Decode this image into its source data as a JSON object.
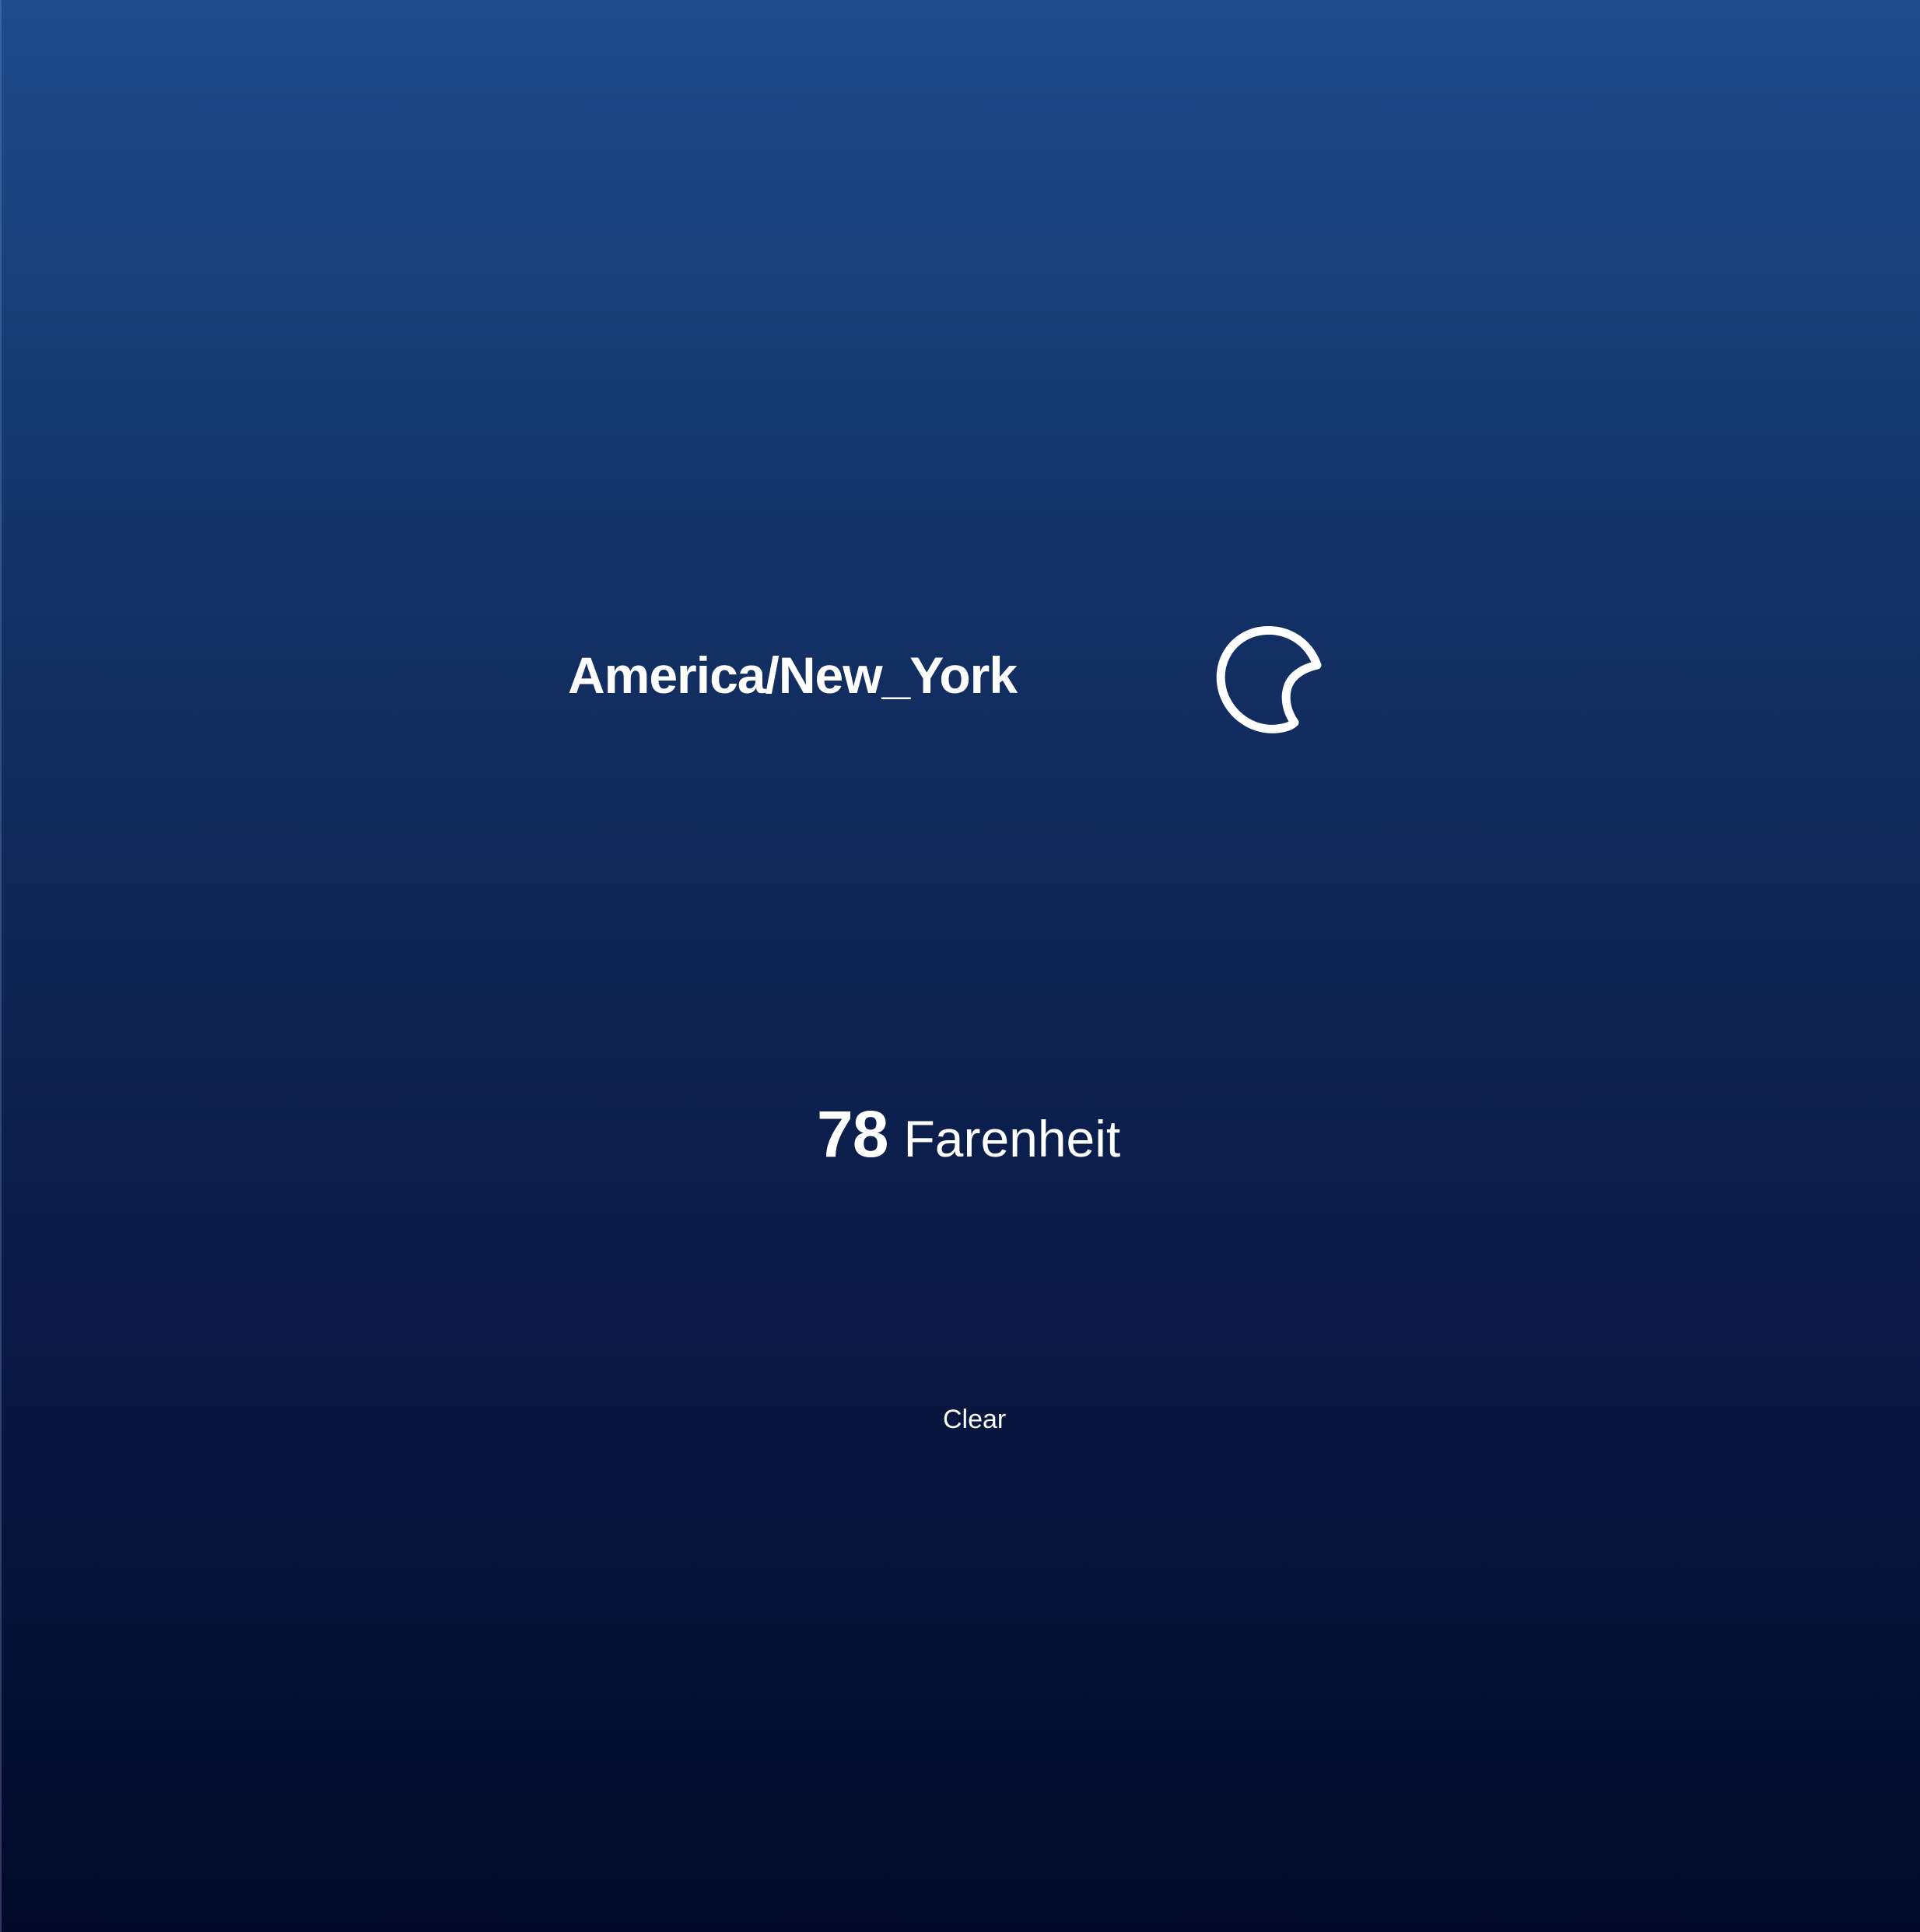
{
  "location": {
    "timezone": "America/New_York"
  },
  "weather": {
    "icon": "crescent-moon-icon",
    "temperature": "78",
    "unit": "Farenheit",
    "condition": "Clear"
  },
  "colors": {
    "gradient_top": "#1d4d8a",
    "gradient_bottom": "#020928",
    "text": "#ffffff"
  }
}
